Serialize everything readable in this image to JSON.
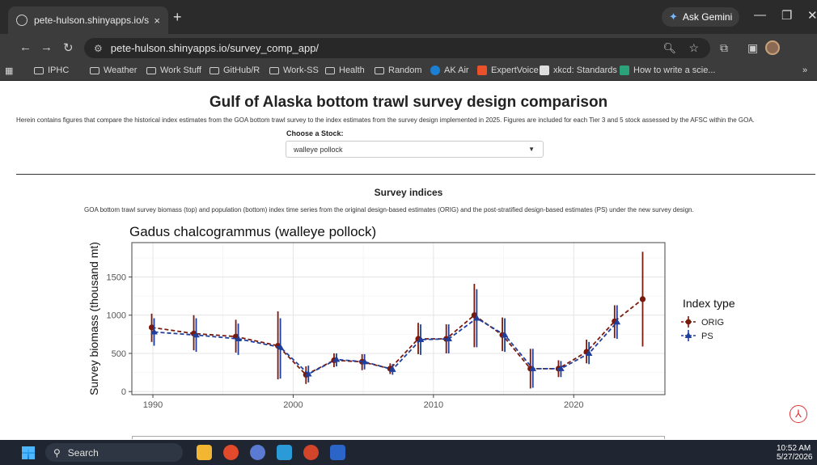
{
  "browser": {
    "tab_title": "pete-hulson.shinyapps.io/surve",
    "tab_close": "×",
    "new_tab": "+",
    "ask_gemini": "Ask Gemini",
    "url": "pete-hulson.shinyapps.io/survey_comp_app/",
    "bookmarks": [
      "IPHC",
      "Weather",
      "Work Stuff",
      "GitHub/R",
      "Work-SS",
      "Health",
      "Random",
      "AK Air",
      "ExpertVoice",
      "xkcd: Standards",
      "How to write a scie..."
    ],
    "bookmarks_more": "»"
  },
  "page": {
    "title": "Gulf of Alaska bottom trawl survey design comparison",
    "intro": "Herein contains figures that compare the historical index estimates from the GOA bottom trawl survey to the index estimates from the survey design implemented in 2025. Figures are included for each Tier 3 and 5 stock assessed by the AFSC within the GOA.",
    "stock_label": "Choose a Stock:",
    "stock_selected": "walleye pollock",
    "section_title": "Survey indices",
    "section_desc": "GOA bottom trawl survey biomass (top) and population (bottom) index time series from the original design-based estimates (ORIG) and the post-stratified design-based estimates (PS) under the new survey design."
  },
  "chart_data": {
    "type": "line",
    "title": "Gadus chalcogrammus (walleye pollock)",
    "xlabel": "",
    "ylabel": "Survey biomass (thousand mt)",
    "xlim": [
      1988.5,
      2026.5
    ],
    "ylim": [
      -40,
      1950
    ],
    "xticks": [
      1990,
      2000,
      2010,
      2020
    ],
    "yticks": [
      0,
      500,
      1000,
      1500
    ],
    "grid": true,
    "legend_title": "Index type",
    "legend_position": "right",
    "series": [
      {
        "name": "ORIG",
        "color": "#7a1a0c",
        "marker": "circle",
        "points": [
          {
            "x": 1990,
            "y": 840,
            "lo": 650,
            "hi": 1020
          },
          {
            "x": 1993,
            "y": 760,
            "lo": 540,
            "hi": 1000
          },
          {
            "x": 1996,
            "y": 720,
            "lo": 510,
            "hi": 940
          },
          {
            "x": 1999,
            "y": 600,
            "lo": 160,
            "hi": 1050
          },
          {
            "x": 2001,
            "y": 220,
            "lo": 100,
            "hi": 330
          },
          {
            "x": 2003,
            "y": 410,
            "lo": 320,
            "hi": 500
          },
          {
            "x": 2005,
            "y": 390,
            "lo": 280,
            "hi": 490
          },
          {
            "x": 2007,
            "y": 300,
            "lo": 230,
            "hi": 370
          },
          {
            "x": 2009,
            "y": 690,
            "lo": 490,
            "hi": 900
          },
          {
            "x": 2011,
            "y": 690,
            "lo": 500,
            "hi": 880
          },
          {
            "x": 2013,
            "y": 1000,
            "lo": 580,
            "hi": 1410
          },
          {
            "x": 2015,
            "y": 740,
            "lo": 530,
            "hi": 970
          },
          {
            "x": 2017,
            "y": 300,
            "lo": 40,
            "hi": 560
          },
          {
            "x": 2019,
            "y": 300,
            "lo": 190,
            "hi": 410
          },
          {
            "x": 2021,
            "y": 520,
            "lo": 370,
            "hi": 680
          },
          {
            "x": 2023,
            "y": 920,
            "lo": 700,
            "hi": 1130
          },
          {
            "x": 2025,
            "y": 1210,
            "lo": 590,
            "hi": 1830
          }
        ]
      },
      {
        "name": "PS",
        "color": "#1f3f9c",
        "marker": "triangle",
        "points": [
          {
            "x": 1990,
            "y": 780,
            "lo": 600,
            "hi": 960
          },
          {
            "x": 1993,
            "y": 740,
            "lo": 520,
            "hi": 960
          },
          {
            "x": 1996,
            "y": 690,
            "lo": 480,
            "hi": 890
          },
          {
            "x": 1999,
            "y": 580,
            "lo": 170,
            "hi": 960
          },
          {
            "x": 2001,
            "y": 230,
            "lo": 120,
            "hi": 340
          },
          {
            "x": 2003,
            "y": 420,
            "lo": 330,
            "hi": 500
          },
          {
            "x": 2005,
            "y": 390,
            "lo": 290,
            "hi": 490
          },
          {
            "x": 2007,
            "y": 290,
            "lo": 220,
            "hi": 360
          },
          {
            "x": 2009,
            "y": 680,
            "lo": 480,
            "hi": 880
          },
          {
            "x": 2011,
            "y": 690,
            "lo": 500,
            "hi": 880
          },
          {
            "x": 2013,
            "y": 960,
            "lo": 580,
            "hi": 1340
          },
          {
            "x": 2015,
            "y": 740,
            "lo": 520,
            "hi": 960
          },
          {
            "x": 2017,
            "y": 300,
            "lo": 50,
            "hi": 560
          },
          {
            "x": 2019,
            "y": 300,
            "lo": 190,
            "hi": 400
          },
          {
            "x": 2021,
            "y": 500,
            "lo": 360,
            "hi": 650
          },
          {
            "x": 2023,
            "y": 910,
            "lo": 690,
            "hi": 1130
          }
        ]
      }
    ]
  },
  "taskbar": {
    "search_placeholder": "Search",
    "time": "10:52 AM",
    "date": "5/27/2026"
  }
}
